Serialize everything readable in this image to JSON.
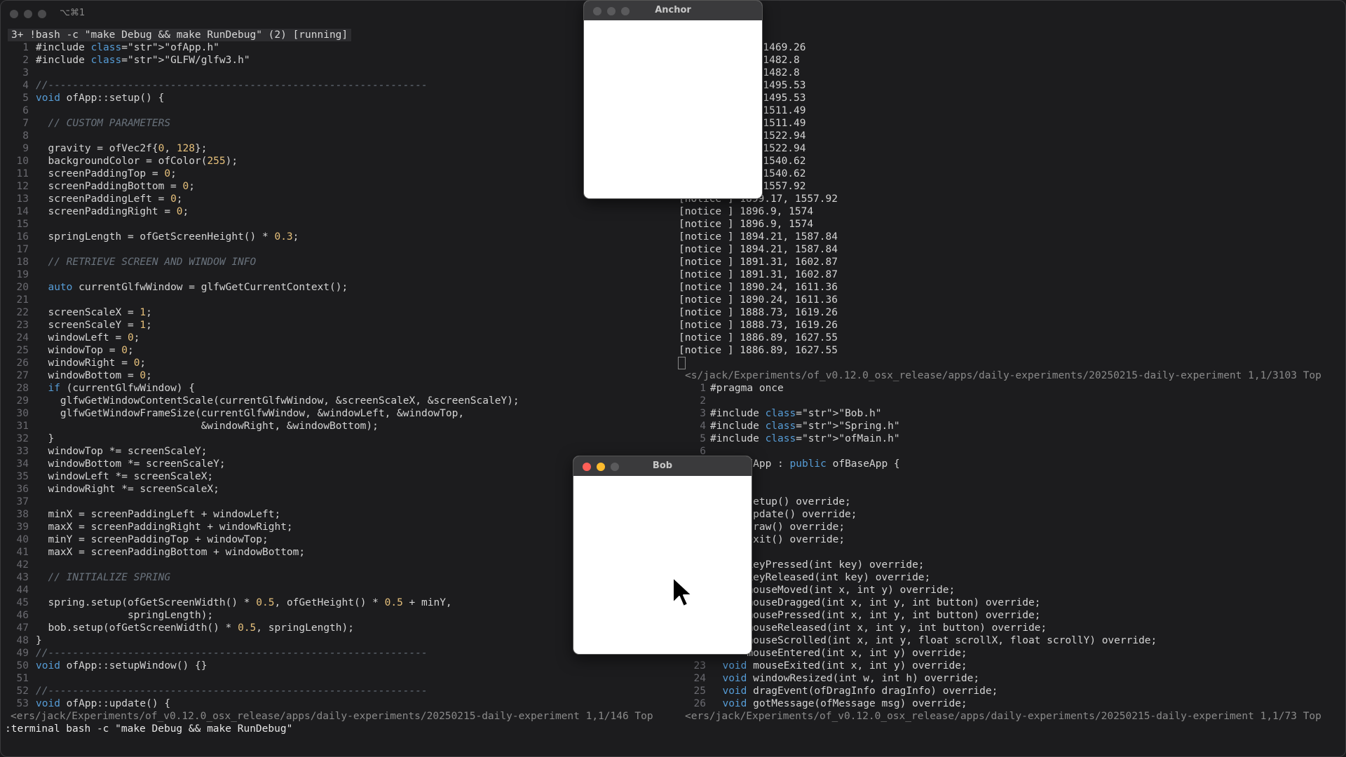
{
  "terminal": {
    "title": "⌥⌘1",
    "tab_label": "3+ !bash -c \"make Debug && make RunDebug\" (2) [running]",
    "cmdline": ":terminal bash -c \"make Debug && make RunDebug\""
  },
  "left_pane": {
    "status": "<ers/jack/Experiments/of_v0.12.0_osx_release/apps/daily-experiments/20250215-daily-experiment 1,1/146 Top",
    "lines": [
      {
        "n": "1",
        "t": "#include \"ofApp.h\""
      },
      {
        "n": "2",
        "t": "#include \"GLFW/glfw3.h\""
      },
      {
        "n": "3",
        "t": ""
      },
      {
        "n": "4",
        "t": "//--------------------------------------------------------------"
      },
      {
        "n": "5",
        "t": "void ofApp::setup() {"
      },
      {
        "n": "6",
        "t": ""
      },
      {
        "n": "7",
        "t": "  // CUSTOM PARAMETERS"
      },
      {
        "n": "8",
        "t": ""
      },
      {
        "n": "9",
        "t": "  gravity = ofVec2f{0, 128};"
      },
      {
        "n": "10",
        "t": "  backgroundColor = ofColor(255);"
      },
      {
        "n": "11",
        "t": "  screenPaddingTop = 0;"
      },
      {
        "n": "12",
        "t": "  screenPaddingBottom = 0;"
      },
      {
        "n": "13",
        "t": "  screenPaddingLeft = 0;"
      },
      {
        "n": "14",
        "t": "  screenPaddingRight = 0;"
      },
      {
        "n": "15",
        "t": ""
      },
      {
        "n": "16",
        "t": "  springLength = ofGetScreenHeight() * 0.3;"
      },
      {
        "n": "17",
        "t": ""
      },
      {
        "n": "18",
        "t": "  // RETRIEVE SCREEN AND WINDOW INFO"
      },
      {
        "n": "19",
        "t": ""
      },
      {
        "n": "20",
        "t": "  auto currentGlfwWindow = glfwGetCurrentContext();"
      },
      {
        "n": "21",
        "t": ""
      },
      {
        "n": "22",
        "t": "  screenScaleX = 1;"
      },
      {
        "n": "23",
        "t": "  screenScaleY = 1;"
      },
      {
        "n": "24",
        "t": "  windowLeft = 0;"
      },
      {
        "n": "25",
        "t": "  windowTop = 0;"
      },
      {
        "n": "26",
        "t": "  windowRight = 0;"
      },
      {
        "n": "27",
        "t": "  windowBottom = 0;"
      },
      {
        "n": "28",
        "t": "  if (currentGlfwWindow) {"
      },
      {
        "n": "29",
        "t": "    glfwGetWindowContentScale(currentGlfwWindow, &screenScaleX, &screenScaleY);"
      },
      {
        "n": "30",
        "t": "    glfwGetWindowFrameSize(currentGlfwWindow, &windowLeft, &windowTop,"
      },
      {
        "n": "31",
        "t": "                           &windowRight, &windowBottom);"
      },
      {
        "n": "32",
        "t": "  }"
      },
      {
        "n": "33",
        "t": "  windowTop *= screenScaleY;"
      },
      {
        "n": "34",
        "t": "  windowBottom *= screenScaleY;"
      },
      {
        "n": "35",
        "t": "  windowLeft *= screenScaleX;"
      },
      {
        "n": "36",
        "t": "  windowRight *= screenScaleX;"
      },
      {
        "n": "37",
        "t": ""
      },
      {
        "n": "38",
        "t": "  minX = screenPaddingLeft + windowLeft;"
      },
      {
        "n": "39",
        "t": "  maxX = screenPaddingRight + windowRight;"
      },
      {
        "n": "40",
        "t": "  minY = screenPaddingTop + windowTop;"
      },
      {
        "n": "41",
        "t": "  maxX = screenPaddingBottom + windowBottom;"
      },
      {
        "n": "42",
        "t": ""
      },
      {
        "n": "43",
        "t": "  // INITIALIZE SPRING"
      },
      {
        "n": "44",
        "t": ""
      },
      {
        "n": "45",
        "t": "  spring.setup(ofGetScreenWidth() * 0.5, ofGetHeight() * 0.5 + minY,"
      },
      {
        "n": "46",
        "t": "               springLength);"
      },
      {
        "n": "47",
        "t": "  bob.setup(ofGetScreenWidth() * 0.5, springLength);"
      },
      {
        "n": "48",
        "t": "}"
      },
      {
        "n": "49",
        "t": "//--------------------------------------------------------------"
      },
      {
        "n": "50",
        "t": "void ofApp::setupWindow() {}"
      },
      {
        "n": "51",
        "t": ""
      },
      {
        "n": "52",
        "t": "//--------------------------------------------------------------"
      },
      {
        "n": "53",
        "t": "void ofApp::update() {"
      }
    ]
  },
  "right_top": {
    "lines": [
      "0.43, 1469.26",
      "7.79, 1482.8",
      "7.79, 1482.8",
      "4.86, 1495.53",
      "4.86, 1495.53",
      "0.05, 1511.49",
      "0.05, 1511.49",
      "5.29, 1522.94",
      "5.29, 1522.94",
      "2.51, 1540.62",
      "2.51, 1540.62",
      "9.17, 1557.92",
      "[notice ] 1899.17, 1557.92",
      "[notice ] 1896.9, 1574",
      "[notice ] 1896.9, 1574",
      "[notice ] 1894.21, 1587.84",
      "[notice ] 1894.21, 1587.84",
      "[notice ] 1891.31, 1602.87",
      "[notice ] 1891.31, 1602.87",
      "[notice ] 1890.24, 1611.36",
      "[notice ] 1890.24, 1611.36",
      "[notice ] 1888.73, 1619.26",
      "[notice ] 1888.73, 1619.26",
      "[notice ] 1886.89, 1627.55",
      "[notice ] 1886.89, 1627.55"
    ],
    "status": "<s/jack/Experiments/of_v0.12.0_osx_release/apps/daily-experiments/20250215-daily-experiment 1,1/3103 Top"
  },
  "right_bottom": {
    "status": "<ers/jack/Experiments/of_v0.12.0_osx_release/apps/daily-experiments/20250215-daily-experiment 1,1/73 Top",
    "lines": [
      {
        "n": "1",
        "t": "#pragma once"
      },
      {
        "n": "2",
        "t": ""
      },
      {
        "n": "3",
        "t": "#include \"Bob.h\""
      },
      {
        "n": "4",
        "t": "#include \"Spring.h\""
      },
      {
        "n": "5",
        "t": "#include \"ofMain.h\""
      },
      {
        "n": "6",
        "t": ""
      },
      {
        "n": "",
        "t": "      fApp : public ofBaseApp {"
      },
      {
        "n": "",
        "t": ""
      },
      {
        "n": "",
        "t": ""
      },
      {
        "n": "",
        "t": "      setup() override;"
      },
      {
        "n": "",
        "t": "      update() override;"
      },
      {
        "n": "",
        "t": "      draw() override;"
      },
      {
        "n": "",
        "t": "      exit() override;"
      },
      {
        "n": "",
        "t": ""
      },
      {
        "n": "",
        "t": "      keyPressed(int key) override;"
      },
      {
        "n": "",
        "t": "      keyReleased(int key) override;"
      },
      {
        "n": "",
        "t": "      mouseMoved(int x, int y) override;"
      },
      {
        "n": "",
        "t": "      mouseDragged(int x, int y, int button) override;"
      },
      {
        "n": "",
        "t": "      mousePressed(int x, int y, int button) override;"
      },
      {
        "n": "",
        "t": "      mouseReleased(int x, int y, int button) override;"
      },
      {
        "n": "",
        "t": "      mouseScrolled(int x, int y, float scrollX, float scrollY) override;"
      },
      {
        "n": "",
        "t": "      mouseEntered(int x, int y) override;"
      },
      {
        "n": "23",
        "t": "  void mouseExited(int x, int y) override;"
      },
      {
        "n": "24",
        "t": "  void windowResized(int w, int h) override;"
      },
      {
        "n": "25",
        "t": "  void dragEvent(ofDragInfo dragInfo) override;"
      },
      {
        "n": "26",
        "t": "  void gotMessage(ofMessage msg) override;"
      }
    ]
  },
  "windows": {
    "anchor_title": "Anchor",
    "bob_title": "Bob"
  },
  "colors": {
    "background": "#1c1c1e",
    "keyword": "#569cd6",
    "string_number": "#e6c07b",
    "comment": "#6a737d"
  }
}
